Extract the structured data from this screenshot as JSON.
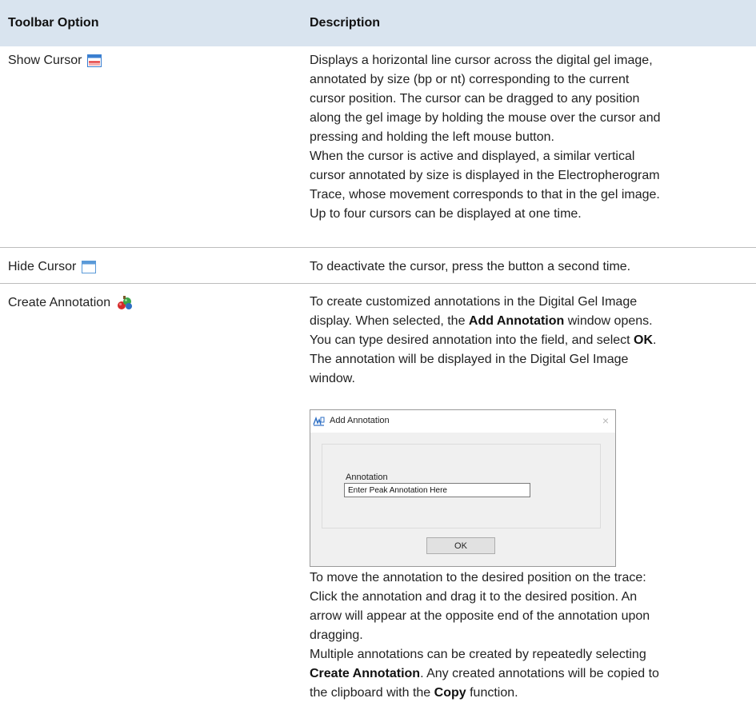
{
  "header": {
    "col1": "Toolbar Option",
    "col2": "Description"
  },
  "rows": [
    {
      "option": "Show Cursor",
      "icon": "show-cursor-icon",
      "lines": [
        "Displays a horizontal line cursor across the digital gel image,",
        "annotated by size (bp or nt) corresponding to the current",
        "cursor position. The cursor can be dragged to any position",
        "along the gel image by holding the mouse over the cursor and",
        "pressing and holding the left mouse button.",
        "When the cursor is active and displayed, a similar vertical",
        "cursor annotated by size is displayed in the Electropherogram",
        "Trace, whose movement corresponds to that in the gel image.",
        "Up to four cursors can be displayed at one time."
      ]
    },
    {
      "option": "Hide Cursor",
      "icon": "hide-cursor-icon",
      "lines": [
        "To deactivate the cursor, press the button a second time."
      ]
    },
    {
      "option": "Create Annotation",
      "icon": "create-annotation-icon",
      "intro": {
        "l1": "To create customized annotations in the Digital Gel Image",
        "l2a": "display. When selected, the ",
        "l2b": "Add Annotation",
        "l2c": " window opens.",
        "l3a": "You can type desired annotation into the field, and select ",
        "l3b": "OK",
        "l3c": ".",
        "l4": "The annotation will be displayed in the Digital Gel Image",
        "l5": "window."
      },
      "after": {
        "l1": "To move the annotation to the desired position on the trace:",
        "l2": "Click the annotation and drag it to the desired position. An",
        "l3": "arrow will appear at the opposite end of the annotation upon",
        "l4": "dragging.",
        "l5": "Multiple annotations can be created by repeatedly selecting",
        "l6a": "Create Annotation",
        "l6b": ". Any created annotations will be copied to",
        "l7a": "the clipboard with the ",
        "l7b": "Copy",
        "l7c": " function."
      }
    }
  ],
  "dialog": {
    "title": "Add Annotation",
    "close_glyph": "×",
    "field_label": "Annotation",
    "field_value": "Enter Peak Annotation Here",
    "ok_label": "OK"
  }
}
